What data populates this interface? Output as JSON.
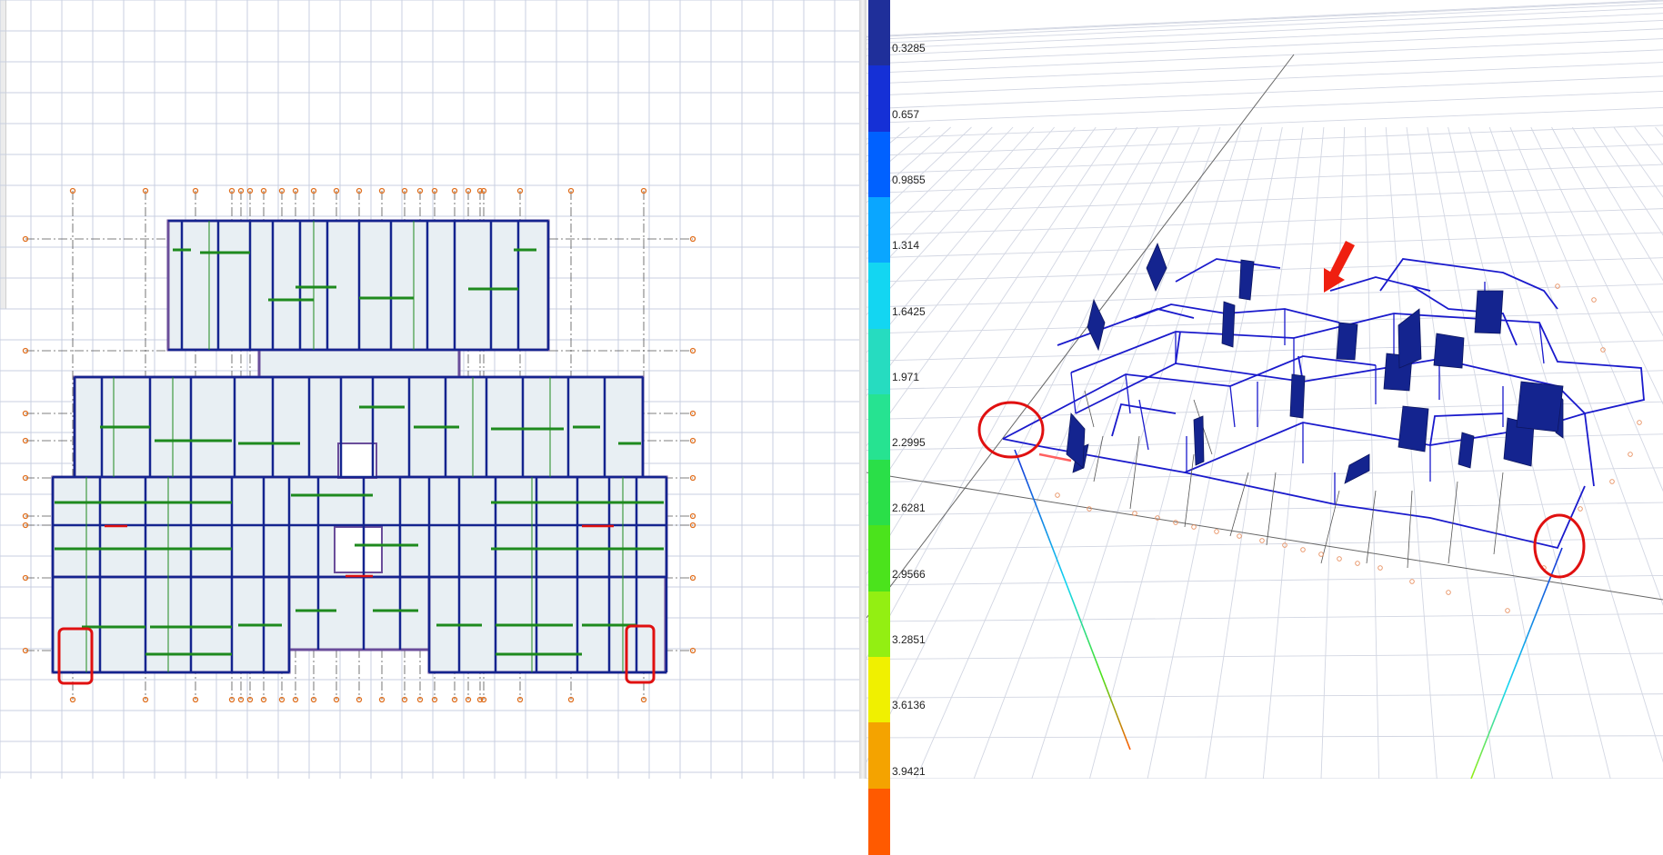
{
  "legend": {
    "colors": [
      "#1f2f9a",
      "#1530d6",
      "#0061ff",
      "#0aa6ff",
      "#13d6f2",
      "#26dcc0",
      "#26e391",
      "#2adf48",
      "#4be31c",
      "#93ef12",
      "#f0f000",
      "#f4a300",
      "#ff5a00"
    ],
    "labels": [
      "0.3285",
      "0.657",
      "0.9855",
      "1.314",
      "1.6425",
      "1.971",
      "2.2995",
      "2.6281",
      "2.9566",
      "3.2851",
      "3.6136",
      "3.9421"
    ]
  },
  "colors": {
    "frame": "#1a1acc",
    "wall": "#14248f",
    "beam_green": "#1e8a1e",
    "highlight": "#e01010",
    "axis_bubble": "#e07020",
    "grid": "#c8cfe0"
  },
  "annotations": {
    "plan_markers": 2,
    "view3d_circles": 2,
    "view3d_arrow": 1
  }
}
